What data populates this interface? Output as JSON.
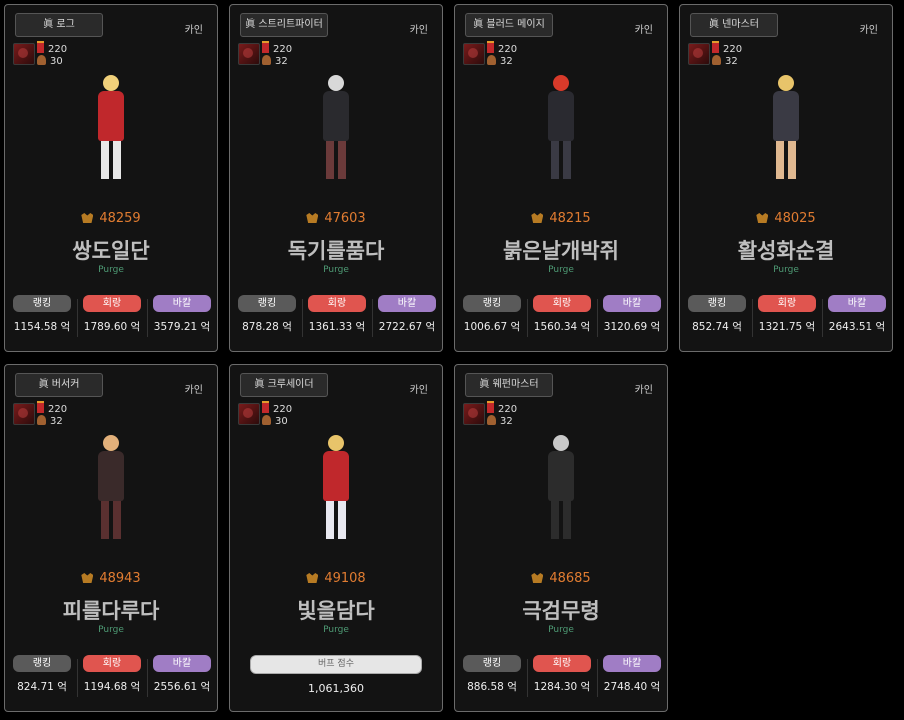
{
  "cards": [
    {
      "class": "眞 로그",
      "server": "카인",
      "level": "220",
      "fame_level": "30",
      "score": "48259",
      "name": "쌍도일단",
      "guild": "Purge",
      "type": "stats",
      "stats": [
        {
          "label": "랭킹",
          "value": "1154.58 억"
        },
        {
          "label": "회랑",
          "value": "1789.60 억"
        },
        {
          "label": "바칼",
          "value": "3579.21 억"
        }
      ],
      "colors": {
        "hair": "#f0d07a",
        "outfit": "#c0282c",
        "legs": "#e8e8e8"
      }
    },
    {
      "class": "眞 스트리트파이터",
      "server": "카인",
      "level": "220",
      "fame_level": "32",
      "score": "47603",
      "name": "독기를품다",
      "guild": "Purge",
      "type": "stats",
      "stats": [
        {
          "label": "랭킹",
          "value": "878.28 억"
        },
        {
          "label": "회랑",
          "value": "1361.33 억"
        },
        {
          "label": "바칼",
          "value": "2722.67 억"
        }
      ],
      "colors": {
        "hair": "#d8d8d8",
        "outfit": "#2a2a2e",
        "legs": "#6b3a3a"
      }
    },
    {
      "class": "眞 블러드 메이지",
      "server": "카인",
      "level": "220",
      "fame_level": "32",
      "score": "48215",
      "name": "붉은날개박쥐",
      "guild": "Purge",
      "type": "stats",
      "stats": [
        {
          "label": "랭킹",
          "value": "1006.67 억"
        },
        {
          "label": "회랑",
          "value": "1560.34 억"
        },
        {
          "label": "바칼",
          "value": "3120.69 억"
        }
      ],
      "colors": {
        "hair": "#d83a2a",
        "outfit": "#2a2a30",
        "legs": "#3a3a44"
      }
    },
    {
      "class": "眞 넨마스터",
      "server": "카인",
      "level": "220",
      "fame_level": "32",
      "score": "48025",
      "name": "활성화순결",
      "guild": "Purge",
      "type": "stats",
      "stats": [
        {
          "label": "랭킹",
          "value": "852.74 억"
        },
        {
          "label": "회랑",
          "value": "1321.75 억"
        },
        {
          "label": "바칼",
          "value": "2643.51 억"
        }
      ],
      "colors": {
        "hair": "#e8c46a",
        "outfit": "#3a3a44",
        "legs": "#e0b890"
      }
    },
    {
      "class": "眞 버서커",
      "server": "카인",
      "level": "220",
      "fame_level": "32",
      "score": "48943",
      "name": "피를다루다",
      "guild": "Purge",
      "type": "stats",
      "stats": [
        {
          "label": "랭킹",
          "value": "824.71 억"
        },
        {
          "label": "회랑",
          "value": "1194.68 억"
        },
        {
          "label": "바칼",
          "value": "2556.61 억"
        }
      ],
      "colors": {
        "hair": "#e2b07a",
        "outfit": "#3a2a2a",
        "legs": "#5a3030"
      }
    },
    {
      "class": "眞 크루세이더",
      "server": "카인",
      "level": "220",
      "fame_level": "30",
      "score": "49108",
      "name": "빛을담다",
      "guild": "Purge",
      "type": "buff",
      "buff_label": "버프 점수",
      "buff_value": "1,061,360",
      "colors": {
        "hair": "#e8c46a",
        "outfit": "#c0282c",
        "legs": "#e8e8f0"
      }
    },
    {
      "class": "眞 웨펀마스터",
      "server": "카인",
      "level": "220",
      "fame_level": "32",
      "score": "48685",
      "name": "극검무령",
      "guild": "Purge",
      "type": "stats",
      "stats": [
        {
          "label": "랭킹",
          "value": "886.58 억"
        },
        {
          "label": "회랑",
          "value": "1284.30 억"
        },
        {
          "label": "바칼",
          "value": "2748.40 억"
        }
      ],
      "colors": {
        "hair": "#c8c8c8",
        "outfit": "#2c2c2c",
        "legs": "#2c2c2c"
      }
    }
  ]
}
